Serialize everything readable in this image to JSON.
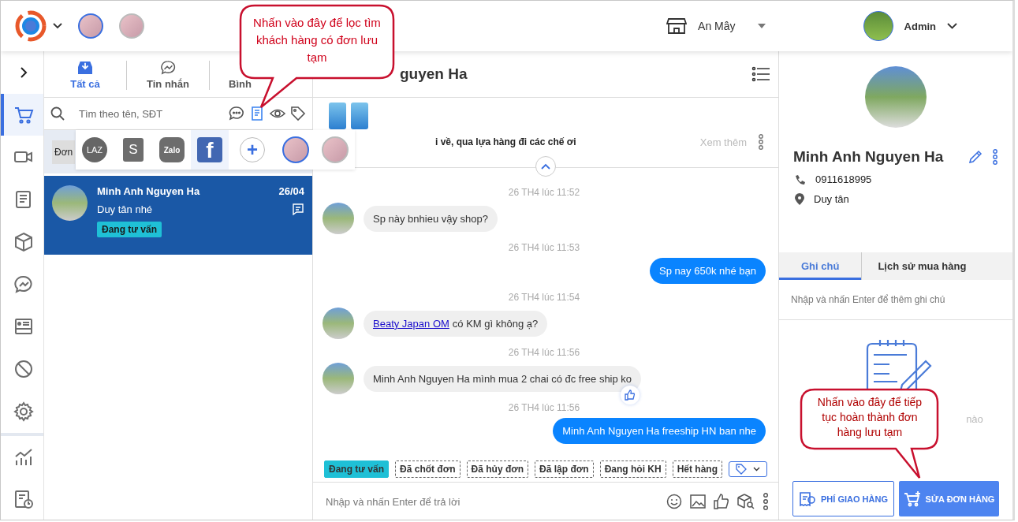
{
  "topbar": {
    "accounts": [
      {
        "selected": true
      },
      {
        "selected": false
      }
    ],
    "store": "An Mây",
    "user": "Admin"
  },
  "rail": {
    "items": [
      {
        "kind": "expand",
        "selected": false
      },
      {
        "kind": "cart",
        "selected": true
      },
      {
        "kind": "video",
        "selected": false
      },
      {
        "kind": "orders",
        "selected": false
      },
      {
        "kind": "products",
        "selected": false
      },
      {
        "kind": "messages",
        "selected": false
      },
      {
        "kind": "contacts",
        "selected": false
      },
      {
        "kind": "blocked",
        "selected": false
      },
      {
        "kind": "settings",
        "selected": false
      }
    ],
    "bottom_items": [
      {
        "kind": "reports",
        "selected": false
      },
      {
        "kind": "history",
        "selected": false
      }
    ]
  },
  "inbox": {
    "tabs": [
      {
        "label": "Tất cả",
        "kind": "all",
        "selected": true
      },
      {
        "label": "Tin nhắn",
        "kind": "messages",
        "selected": false
      },
      {
        "label": "Bình",
        "kind": "comments",
        "selected": false
      }
    ],
    "search": {
      "placeholder": "Tìm theo tên, SĐT"
    },
    "filters": [
      {
        "kind": "unread",
        "selected": false
      },
      {
        "kind": "draft_orders",
        "selected": true
      },
      {
        "kind": "seen",
        "selected": false
      },
      {
        "kind": "tags",
        "selected": false
      }
    ],
    "filter_label": "Đơn",
    "channels": [
      {
        "kind": "lazada",
        "label": "LAZ",
        "selected": false
      },
      {
        "kind": "shopee",
        "label": "S",
        "selected": false
      },
      {
        "kind": "zalo",
        "label": "Zalo",
        "selected": false
      },
      {
        "kind": "facebook",
        "label": "f",
        "selected": true
      },
      {
        "kind": "add",
        "label": "+",
        "selected": false
      },
      {
        "kind": "account",
        "selected": true
      },
      {
        "kind": "account",
        "selected": false
      }
    ],
    "conversations": [
      {
        "name": "Minh Anh Nguyen Ha",
        "date": "26/04",
        "preview": "Duy tân nhé",
        "tag": "Đang tư vấn",
        "selected": true
      }
    ]
  },
  "chat": {
    "contact_name": "guyen Ha",
    "pinned": {
      "text": "i về, qua lựa hàng đi các chế ơi",
      "more": "Xem thêm"
    },
    "messages": [
      {
        "time": "26 TH4 lúc 11:52",
        "kind": "incoming",
        "text": "Sp này bnhieu vậy shop?",
        "liked": false
      },
      {
        "time": "26 TH4 lúc 11:53",
        "kind": "outgoing",
        "text": "Sp nay 650k nhé bạn",
        "liked": false
      },
      {
        "time": "26 TH4 lúc 11:54",
        "kind": "incoming",
        "link": "Beaty Japan OM",
        "text": "có KM gì không ạ?",
        "liked": false
      },
      {
        "time": "26 TH4 lúc 11:56",
        "kind": "incoming",
        "text": "Minh Anh Nguyen Ha mình mua 2 chai có đc free ship ko",
        "liked": true
      },
      {
        "time": "26 TH4 lúc 11:56",
        "kind": "outgoing",
        "text": "Minh Anh Nguyen Ha freeship HN ban nhe",
        "liked": false
      }
    ],
    "tags": [
      {
        "label": "Đang tư vấn",
        "selected": true
      },
      {
        "label": "Đã chốt đơn",
        "selected": false
      },
      {
        "label": "Đã hủy đơn",
        "selected": false
      },
      {
        "label": "Đã lập đơn",
        "selected": false
      },
      {
        "label": "Đang hỏi KH",
        "selected": false
      },
      {
        "label": "Hết hàng",
        "selected": false
      }
    ],
    "reply": {
      "placeholder": "Nhập và nhấn Enter để trả lời"
    }
  },
  "customer": {
    "name": "Minh Anh Nguyen Ha",
    "phone": "0911618995",
    "address": "Duy tân",
    "tabs": [
      {
        "label": "Ghi chú",
        "selected": true
      },
      {
        "label": "Lịch sử mua hàng",
        "selected": false
      }
    ],
    "note": {
      "placeholder": "Nhập và nhấn Enter để thêm ghi chú"
    },
    "empty_text": "nào",
    "buttons": [
      {
        "label": "PHÍ GIAO HÀNG",
        "kind": "outline"
      },
      {
        "label": "SỬA ĐƠN HÀNG",
        "kind": "primary"
      }
    ]
  },
  "callouts": [
    {
      "text": "Nhấn vào đây để lọc tìm khách hàng có đơn lưu tạm"
    },
    {
      "text": "Nhấn vào đây để tiếp tục hoàn thành đơn hàng lưu tạm"
    }
  ]
}
